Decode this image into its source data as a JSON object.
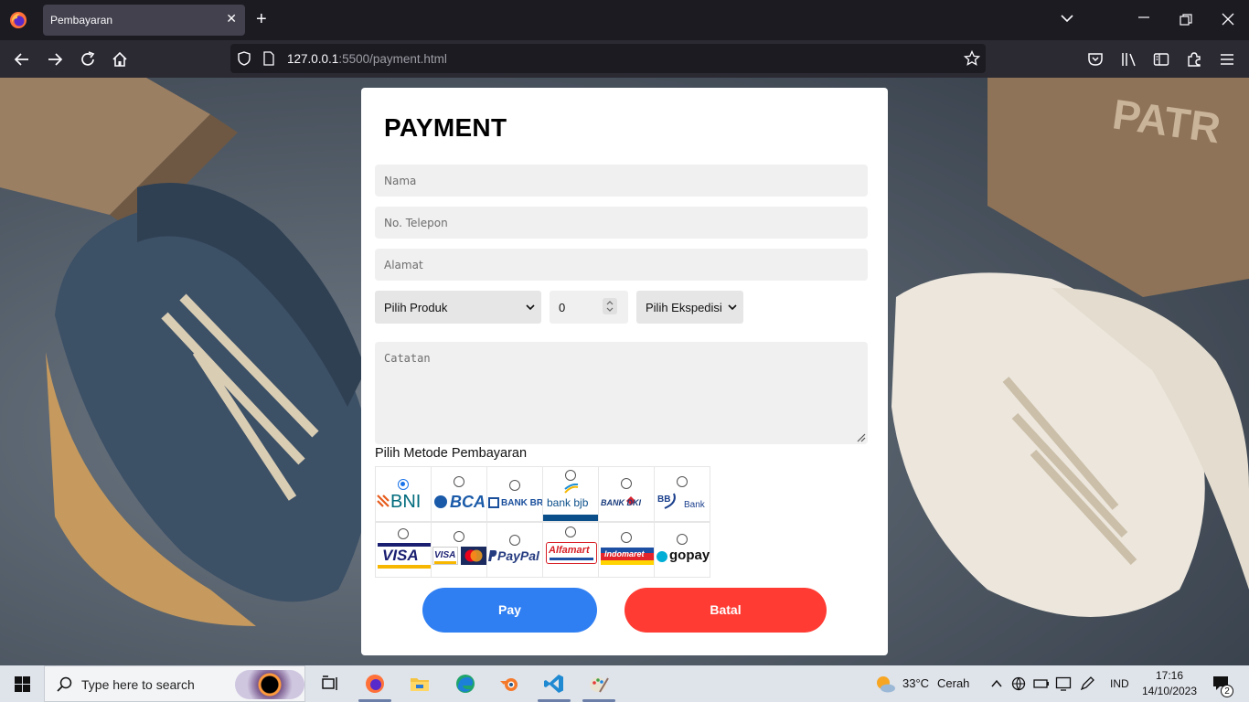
{
  "browser": {
    "tab_title": "Pembayaran",
    "tab_close": "✕",
    "new_tab": "+",
    "url_host": "127.0.0.1",
    "url_rest": ":5500/payment.html"
  },
  "form": {
    "title": "PAYMENT",
    "name_placeholder": "Nama",
    "phone_placeholder": "No. Telepon",
    "address_placeholder": "Alamat",
    "product_select": "Pilih Produk",
    "quantity_value": "0",
    "courier_select": "Pilih Ekspedisi",
    "notes_placeholder": "Catatan",
    "payment_method_label": "Pilih Metode Pembayaran",
    "payment_methods": [
      {
        "name": "BNI",
        "selected": true
      },
      {
        "name": "BCA",
        "selected": false
      },
      {
        "name": "BANK BRI",
        "selected": false
      },
      {
        "name": "bank bjb",
        "selected": false
      },
      {
        "name": "BANK DKI",
        "selected": false
      },
      {
        "name": "Bank",
        "selected": false
      },
      {
        "name": "VISA",
        "selected": false
      },
      {
        "name": "VISA",
        "selected": false
      },
      {
        "name": "PayPal",
        "selected": false
      },
      {
        "name": "Alfamart",
        "selected": false
      },
      {
        "name": "Indomaret",
        "selected": false
      },
      {
        "name": "gopay",
        "selected": false
      }
    ],
    "pay_button": "Pay",
    "cancel_button": "Batal"
  },
  "taskbar": {
    "search_placeholder": "Type here to search",
    "weather_temp": "33°C",
    "weather_text": "Cerah",
    "language": "IND",
    "time": "17:16",
    "date": "14/10/2023",
    "notification_count": "2"
  },
  "colors": {
    "pay": "#2f7ff3",
    "cancel": "#ff3b33",
    "radio_selected": "#1a73e8"
  }
}
